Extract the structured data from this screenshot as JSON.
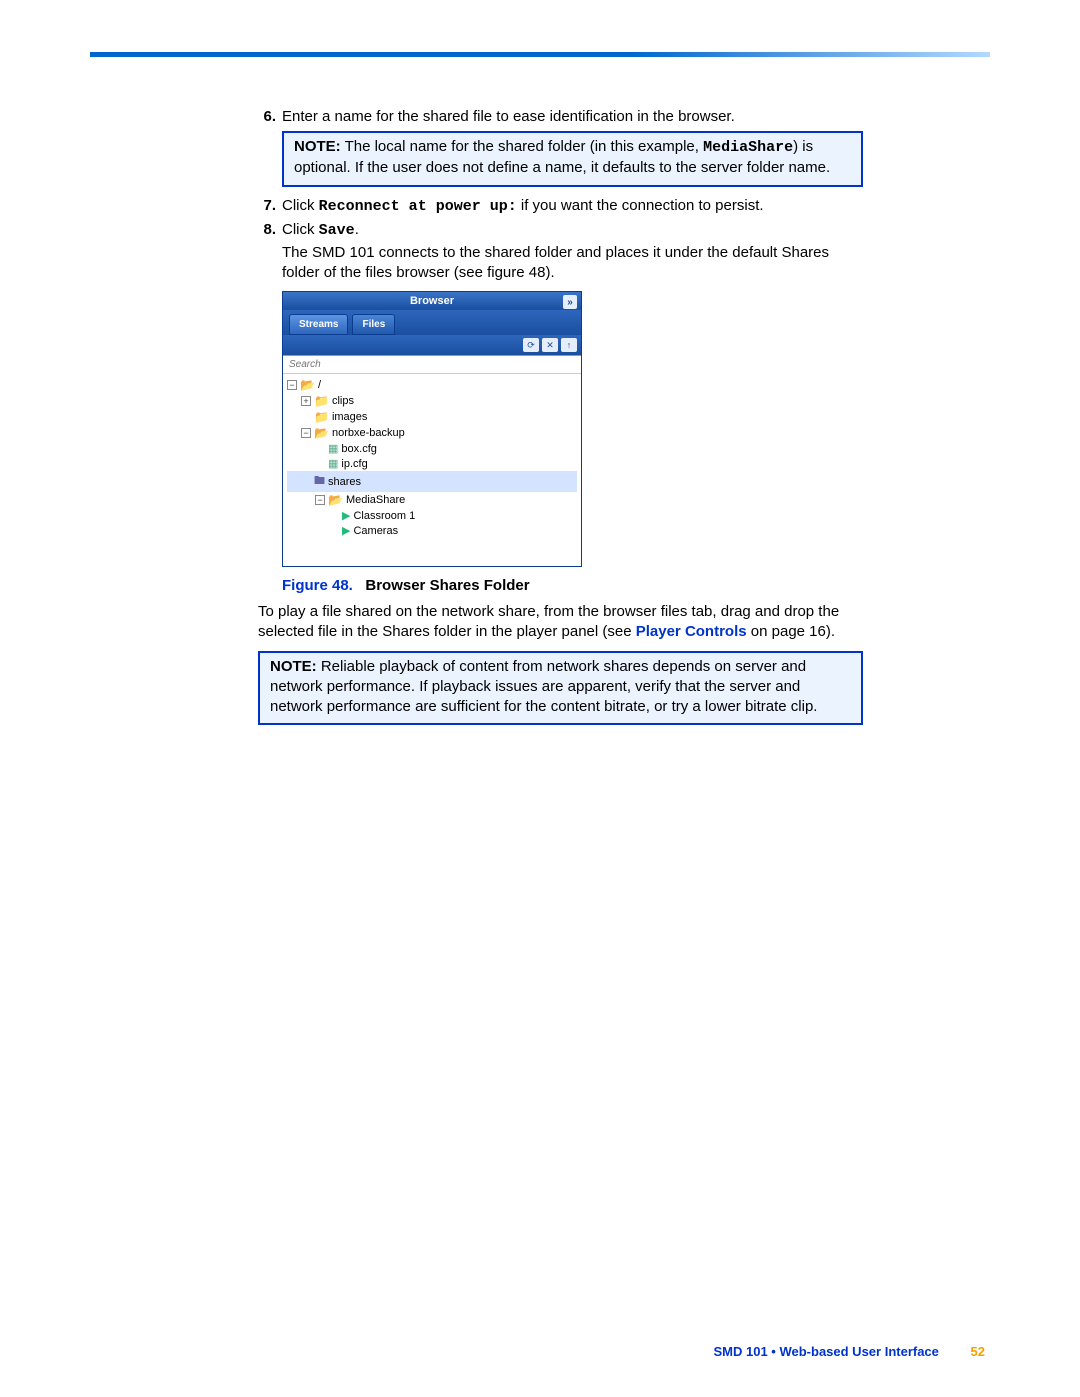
{
  "steps": {
    "s6": {
      "num": "6.",
      "text": "Enter a name for the shared file to ease identification in the browser."
    },
    "s7": {
      "num": "7.",
      "pre": "Click ",
      "mono": "Reconnect at power up:",
      "post": " if you want the connection to persist."
    },
    "s8": {
      "num": "8.",
      "pre": "Click ",
      "mono": "Save",
      "post": ".",
      "followup": "The SMD 101 connects to the shared folder and places it under the default Shares folder of the files browser (see figure 48)."
    }
  },
  "note1": {
    "label": "NOTE:",
    "pre": "The local name for the shared folder (in this example, ",
    "mono": "MediaShare",
    "post": ") is optional. If the user does not define a name, it defaults to the server folder name."
  },
  "browser": {
    "title": "Browser",
    "tabs": {
      "streams": "Streams",
      "files": "Files"
    },
    "search_placeholder": "Search",
    "tree": {
      "root": "/",
      "clips": "clips",
      "images": "images",
      "norbxe": "norbxe-backup",
      "boxcfg": "box.cfg",
      "ipcfg": "ip.cfg",
      "shares": "shares",
      "mediashare": "MediaShare",
      "classroom": "Classroom 1",
      "cameras": "Cameras"
    }
  },
  "figure": {
    "label": "Figure 48.",
    "title": "Browser Shares Folder"
  },
  "play_para": {
    "pre": "To play a file shared on the network share, from the browser files tab, drag and drop the selected file in the Shares folder in the player panel (see ",
    "link": "Player Controls",
    "post": " on page 16)."
  },
  "note2": {
    "label": "NOTE:",
    "text": "Reliable playback of content from network shares depends on server and network performance. If playback issues are apparent, verify that the server and network performance are sufficient for the content bitrate, or try a lower bitrate clip."
  },
  "footer": {
    "text": "SMD 101 • Web-based User Interface",
    "page": "52"
  }
}
